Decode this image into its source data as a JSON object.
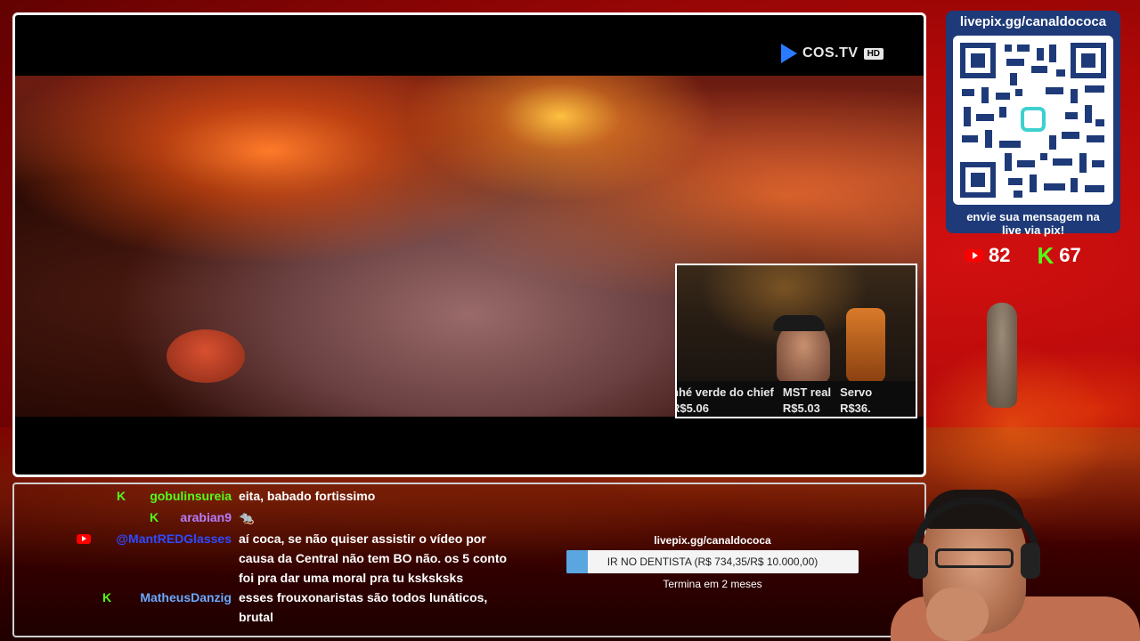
{
  "player": {
    "brand": "COS.TV",
    "quality_badge": "HD",
    "inner_ticker": [
      {
        "name": "nhé verde do chief",
        "amount": "R$5.06"
      },
      {
        "name": "MST real",
        "amount": "R$5.03"
      },
      {
        "name": "Servo",
        "amount": "R$36."
      }
    ]
  },
  "sidebar": {
    "qr_title": "livepix.gg/canaldococa",
    "qr_message_line1": "envie sua mensagem na",
    "qr_message_line2": "live via pix!",
    "youtube_viewers": "82",
    "kick_viewers": "67",
    "youtube_icon": "youtube-icon",
    "kick_icon": "kick-icon"
  },
  "chat": {
    "messages": [
      {
        "platform": "kick",
        "user": "gobulinsureia",
        "user_color": "#53fc18",
        "text": "eita, babado fortissimo"
      },
      {
        "platform": "kick",
        "user": "arabian9",
        "user_color": "#b57cff",
        "text": "🐀"
      },
      {
        "platform": "youtube",
        "user": "@MantREDGlasses",
        "user_color": "#2d4bff",
        "text": "aí coca, se não quiser assistir o vídeo por\ncausa da Central não tem BO não. os 5 conto\nfoi pra dar uma moral pra tu ksksksks"
      },
      {
        "platform": "kick",
        "user": "MatheusDanzig",
        "user_color": "#6aa8ff",
        "text": "esses frouxonaristas são todos lunáticos,\nbrutal"
      }
    ]
  },
  "goal": {
    "url": "livepix.gg/canaldococa",
    "label": "IR NO DENTISTA (R$ 734,35/R$ 10.000,00)",
    "progress_fraction": 0.0734,
    "footer": "Termina em 2 meses",
    "fill_color": "#5aa6e0"
  },
  "colors": {
    "kick_green": "#53fc18",
    "youtube_red": "#ff0000",
    "qr_card": "#1e3a78"
  }
}
